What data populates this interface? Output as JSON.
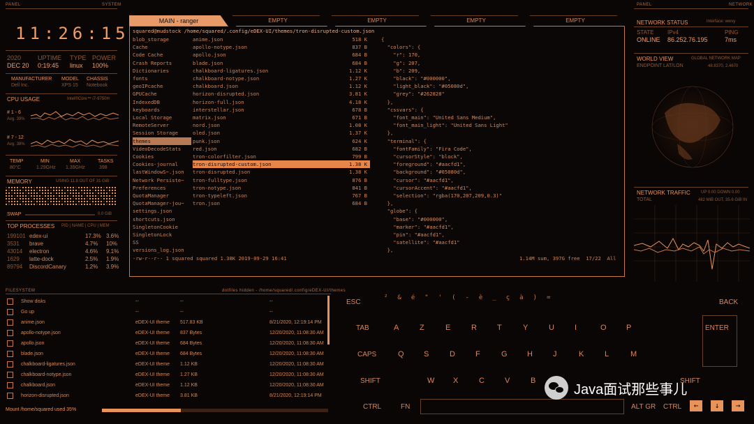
{
  "headers": {
    "panel_left": "PANEL",
    "system": "SYSTEM",
    "panel_right": "PANEL",
    "network": "NETWORK",
    "filesystem": "FILESYSTEM"
  },
  "clock": {
    "time": "11:26:15"
  },
  "sysinfo": {
    "year": "2020",
    "date": "DEC 20",
    "uptime_label": "UPTIME",
    "uptime": "0:19:45",
    "type_label": "TYPE",
    "type": "linux",
    "power_label": "POWER",
    "power": "100%",
    "manufacturer_label": "MANUFACTURER",
    "manufacturer": "Dell Inc.",
    "model_label": "MODEL",
    "model": "XPS 15",
    "chassis_label": "CHASSIS",
    "chassis": "Notebook"
  },
  "cpu": {
    "title": "CPU USAGE",
    "chip": "Intel®Core™ i7-9750H",
    "g1": "# 1 - 6",
    "g1avg": "Avg. 39%",
    "g2": "# 7 - 12",
    "g2avg": "Avg. 38%",
    "temp_label": "TEMP",
    "temp": "80°C",
    "min_label": "MIN",
    "min": "1.29GHz",
    "max_label": "MAX",
    "max": "1.39GHz",
    "tasks_label": "TASKS",
    "tasks": "398"
  },
  "memory": {
    "title": "MEMORY",
    "usage": "USING 11.8 OUT OF 31 GiB",
    "swap": "SWAP",
    "swap_val": "0.0 GiB"
  },
  "processes": {
    "title": "TOP PROCESSES",
    "cols": "PID | NAME | CPU | MEM",
    "rows": [
      {
        "pid": "199101",
        "name": "edex-ui",
        "cpu": "17.3%",
        "mem": "3.6%"
      },
      {
        "pid": "3531",
        "name": "brave",
        "cpu": "4.7%",
        "mem": "10%"
      },
      {
        "pid": "43014",
        "name": "electron",
        "cpu": "4.6%",
        "mem": "9.1%"
      },
      {
        "pid": "1629",
        "name": "latte-dock",
        "cpu": "2.5%",
        "mem": "1.9%"
      },
      {
        "pid": "89794",
        "name": "DiscordCanary",
        "cpu": "1.2%",
        "mem": "3.9%"
      }
    ]
  },
  "tabs": [
    "MAIN - ranger",
    "EMPTY",
    "EMPTY",
    "EMPTY",
    "EMPTY"
  ],
  "terminal": {
    "prompt": "squared@mudstock",
    "path": "/home/squared/.config/eDEX-UI/themes/tron-disrupted-custom.json",
    "dirs": [
      "blob_storage",
      "Cache",
      "Code Cache",
      "Crash Reports",
      "Dictionaries",
      "fonts",
      "geoIPcache",
      "GPUCache",
      "IndexedDB",
      "keyboards",
      "Local Storage",
      "RemoteServer",
      "Session Storage",
      "themes",
      "VideoDecodeStats",
      "Cookies",
      "Cookies-journal",
      "lastWindowS~.json",
      "Network Persiste~",
      "Preferences",
      "QuotaManager",
      "QuotaManager-jou~",
      "settings.json",
      "shortcuts.json",
      "SingletonCookie",
      "SingletonLock",
      "SS",
      "versions_log.json"
    ],
    "files": [
      {
        "name": "anime.json",
        "size": "518 K"
      },
      {
        "name": "apollo-notype.json",
        "size": "837 B"
      },
      {
        "name": "apollo.json",
        "size": "684 B"
      },
      {
        "name": "blade.json",
        "size": "684 B"
      },
      {
        "name": "chalkboard-ligatures.json",
        "size": "1.12 K"
      },
      {
        "name": "chalkboard-notype.json",
        "size": "1.27 K"
      },
      {
        "name": "chalkboard.json",
        "size": "1.12 K"
      },
      {
        "name": "horizon-disrupted.json",
        "size": "3.81 K"
      },
      {
        "name": "horizon-full.json",
        "size": "4.18 K"
      },
      {
        "name": "interstellar.json",
        "size": "678 B"
      },
      {
        "name": "matrix.json",
        "size": "671 B"
      },
      {
        "name": "nord.json",
        "size": "1.08 K"
      },
      {
        "name": "oled.json",
        "size": "1.37 K"
      },
      {
        "name": "punk.json",
        "size": "624 K"
      },
      {
        "name": "red.json",
        "size": "682 B"
      },
      {
        "name": "tron-colorfilter.json",
        "size": "799 B"
      },
      {
        "name": "tron-disrupted-custom.json",
        "size": "1.38 K"
      },
      {
        "name": "tron-disrupted.json",
        "size": "1.38 K"
      },
      {
        "name": "tron-fulltype.json",
        "size": "876 B"
      },
      {
        "name": "tron-notype.json",
        "size": "841 B"
      },
      {
        "name": "tron-typeleft.json",
        "size": "767 B"
      },
      {
        "name": "tron.json",
        "size": "684 B"
      }
    ],
    "json_lines": [
      "{",
      "  \"colors\": {",
      "    \"r\": 170,",
      "    \"g\": 207,",
      "    \"b\": 209,",
      "    \"black\": \"#000000\",",
      "    \"light_black\": \"#05080d\",",
      "    \"grey\": \"#262828\"",
      "  },",
      "  \"cssvars\": {",
      "    \"font_main\": \"United Sans Medium\",",
      "    \"font_main_light\": \"United Sans Light\"",
      "  },",
      "  \"terminal\": {",
      "    \"fontFamily\": \"Fira Code\",",
      "    \"cursorStyle\": \"block\",",
      "    \"foreground\": \"#aacfd1\",",
      "    \"background\": \"#05080d\",",
      "    \"cursor\": \"#aacfd1\",",
      "    \"cursorAccent\": \"#aacfd1\",",
      "    \"selection\": \"rgba(170,207,209,0.3)\"",
      "  },",
      "  \"globe\": {",
      "    \"base\": \"#000000\",",
      "    \"marker\": \"#aacfd1\",",
      "    \"pin\": \"#aacfd1\",",
      "    \"satellite\": \"#aacfd1\"",
      "  },"
    ],
    "status_left": "-rw-r--r-- 1 squared squared 1.38K 2019-09-29 16:41",
    "status_right": "1.14M sum, 397G free  17/22  All"
  },
  "network": {
    "status_title": "NETWORK STATUS",
    "interface": "Interface: wwvy",
    "state_label": "STATE",
    "state": "ONLINE",
    "ipv4_label": "IPv4",
    "ip": "86.252.76.195",
    "ping_label": "PING",
    "ping": "7ms",
    "world_title": "WORLD VIEW",
    "world_sub": "GLOBAL NETWORK MAP",
    "endpoint_label": "ENDPOINT LAT/LON",
    "endpoint": "48.8370, 2.4670",
    "traffic_title": "NETWORK TRAFFIC",
    "traffic_sub": "UP 0.00 DOWN 0.00",
    "total_label": "TOTAL",
    "total": "482 MiB OUT, 35.6 GiB IN"
  },
  "filesystem": {
    "path_info": "dotfiles hidden - /home/squared/.config/eDEX-UI/themes",
    "rows": [
      {
        "name": "Show disks",
        "type": "--",
        "size": "--",
        "date": "--"
      },
      {
        "name": "Go up",
        "type": "--",
        "size": "--",
        "date": "--"
      },
      {
        "name": "anime.json",
        "type": "eDEX-UI theme",
        "size": "517.83 KB",
        "date": "8/21/2020, 12:19:14 PM"
      },
      {
        "name": "apollo-notype.json",
        "type": "eDEX-UI theme",
        "size": "837 Bytes",
        "date": "12/20/2020, 11:08:30 AM"
      },
      {
        "name": "apollo.json",
        "type": "eDEX-UI theme",
        "size": "684 Bytes",
        "date": "12/20/2020, 11:08:30 AM"
      },
      {
        "name": "blade.json",
        "type": "eDEX-UI theme",
        "size": "684 Bytes",
        "date": "12/20/2020, 11:08:30 AM"
      },
      {
        "name": "chalkboard-ligatures.json",
        "type": "eDEX-UI theme",
        "size": "1.12 KB",
        "date": "12/20/2020, 11:08:30 AM"
      },
      {
        "name": "chalkboard-notype.json",
        "type": "eDEX-UI theme",
        "size": "1.27 KB",
        "date": "12/20/2020, 11:08:30 AM"
      },
      {
        "name": "chalkboard.json",
        "type": "eDEX-UI theme",
        "size": "1.12 KB",
        "date": "12/20/2020, 11:08:30 AM"
      },
      {
        "name": "horizon-disrupted.json",
        "type": "eDEX-UI theme",
        "size": "3.81 KB",
        "date": "8/21/2020, 12:19:14 PM"
      }
    ],
    "mount": "Mount /home/squared used 35%",
    "mount_used": 0.35
  },
  "keyboard": {
    "esc": "ESC",
    "back": "BACK",
    "tab": "TAB",
    "enter": "ENTER",
    "caps": "CAPS",
    "shift": "SHIFT",
    "ctrl": "CTRL",
    "fn": "FN",
    "altgr": "ALT GR",
    "row2": [
      "A",
      "Z",
      "E",
      "R",
      "T",
      "Y",
      "U",
      "I",
      "O",
      "P"
    ],
    "row3": [
      "Q",
      "S",
      "D",
      "F",
      "G",
      "H",
      "J",
      "K",
      "L",
      "M"
    ],
    "row4": [
      "W",
      "X",
      "C",
      "V",
      "B"
    ],
    "shift_r": "SHIFT",
    "arrows": [
      "←",
      "↓",
      "→"
    ]
  },
  "watermark": "Java面试那些事儿",
  "colors": {
    "accent": "#e8935a",
    "bg": "#0a0605",
    "selection": "#e8864a"
  }
}
